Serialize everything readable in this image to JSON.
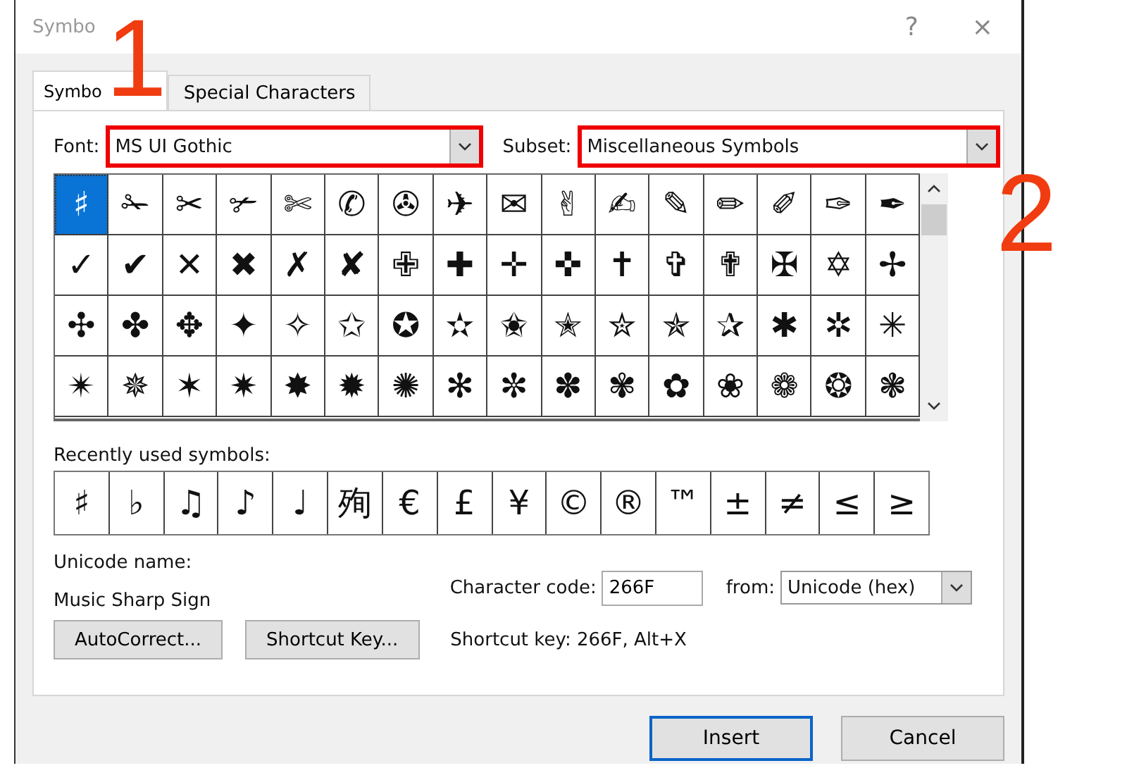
{
  "window": {
    "title": "Symbo",
    "buttons": [
      "?",
      "×"
    ]
  },
  "tabs": [
    {
      "label": "Symbo",
      "selected": true
    },
    {
      "label": "Special Characters",
      "selected": false
    }
  ],
  "font": {
    "label": "Font:",
    "value": "MS UI Gothic",
    "highlighted": true
  },
  "subset": {
    "label": "Subset:",
    "value": "Miscellaneous Symbols",
    "highlighted": true
  },
  "symbol_grid": [
    [
      {
        "char": "♯",
        "selected": true
      },
      {
        "char": "✁",
        "selected": false
      },
      {
        "char": "✂",
        "selected": false
      },
      {
        "char": "✃",
        "selected": false
      },
      {
        "char": "✄",
        "selected": false
      },
      {
        "char": "✆",
        "selected": false
      },
      {
        "char": "✇",
        "selected": false
      },
      {
        "char": "✈",
        "selected": false
      },
      {
        "char": "✉",
        "selected": false
      },
      {
        "char": "✌",
        "selected": false
      },
      {
        "char": "✍",
        "selected": false
      },
      {
        "char": "✎",
        "selected": false
      },
      {
        "char": "✏",
        "selected": false
      },
      {
        "char": "✐",
        "selected": false
      },
      {
        "char": "✑",
        "selected": false
      },
      {
        "char": "✒",
        "selected": false
      }
    ],
    [
      {
        "char": "✓",
        "selected": false
      },
      {
        "char": "✔",
        "selected": false
      },
      {
        "char": "✕",
        "selected": false
      },
      {
        "char": "✖",
        "selected": false
      },
      {
        "char": "✗",
        "selected": false
      },
      {
        "char": "✘",
        "selected": false
      },
      {
        "char": "✙",
        "selected": false
      },
      {
        "char": "✚",
        "selected": false
      },
      {
        "char": "✛",
        "selected": false
      },
      {
        "char": "✜",
        "selected": false
      },
      {
        "char": "✝",
        "selected": false
      },
      {
        "char": "✞",
        "selected": false
      },
      {
        "char": "✟",
        "selected": false
      },
      {
        "char": "✠",
        "selected": false
      },
      {
        "char": "✡",
        "selected": false
      },
      {
        "char": "✢",
        "selected": false
      }
    ],
    [
      {
        "char": "✣",
        "selected": false
      },
      {
        "char": "✤",
        "selected": false
      },
      {
        "char": "✥",
        "selected": false
      },
      {
        "char": "✦",
        "selected": false
      },
      {
        "char": "✧",
        "selected": false
      },
      {
        "char": "✩",
        "selected": false
      },
      {
        "char": "✪",
        "selected": false
      },
      {
        "char": "✫",
        "selected": false
      },
      {
        "char": "✬",
        "selected": false
      },
      {
        "char": "✭",
        "selected": false
      },
      {
        "char": "✮",
        "selected": false
      },
      {
        "char": "✯",
        "selected": false
      },
      {
        "char": "✰",
        "selected": false
      },
      {
        "char": "✱",
        "selected": false
      },
      {
        "char": "✲",
        "selected": false
      },
      {
        "char": "✳",
        "selected": false
      }
    ],
    [
      {
        "char": "✴",
        "selected": false
      },
      {
        "char": "✵",
        "selected": false
      },
      {
        "char": "✶",
        "selected": false
      },
      {
        "char": "✷",
        "selected": false
      },
      {
        "char": "✸",
        "selected": false
      },
      {
        "char": "✹",
        "selected": false
      },
      {
        "char": "✺",
        "selected": false
      },
      {
        "char": "✻",
        "selected": false
      },
      {
        "char": "✼",
        "selected": false
      },
      {
        "char": "✽",
        "selected": false
      },
      {
        "char": "✾",
        "selected": false
      },
      {
        "char": "✿",
        "selected": false
      },
      {
        "char": "❀",
        "selected": false
      },
      {
        "char": "❁",
        "selected": false
      },
      {
        "char": "❂",
        "selected": false
      },
      {
        "char": "❃",
        "selected": false
      }
    ]
  ],
  "recent": {
    "label": "Recently used symbols:",
    "symbols": [
      "♯",
      "♭",
      "♫",
      "♪",
      "♩",
      "殉",
      "€",
      "£",
      "¥",
      "©",
      "®",
      "™",
      "±",
      "≠",
      "≤",
      "≥"
    ]
  },
  "unicode_name": {
    "label": "Unicode name:",
    "value": "Music Sharp Sign"
  },
  "character_code": {
    "label": "Character code:",
    "value": "266F"
  },
  "from": {
    "label": "from:",
    "value": "Unicode (hex)"
  },
  "autocorrect_button": "AutoCorrect...",
  "shortcut_key_button": "Shortcut Key...",
  "shortcut_key_text": "Shortcut key: 266F, Alt+X",
  "buttons": [
    {
      "label": "Insert",
      "default": true
    },
    {
      "label": "Cancel",
      "default": false
    }
  ],
  "annotations": [
    {
      "label": "1",
      "kind": "font"
    },
    {
      "label": "2",
      "kind": "subset"
    }
  ]
}
